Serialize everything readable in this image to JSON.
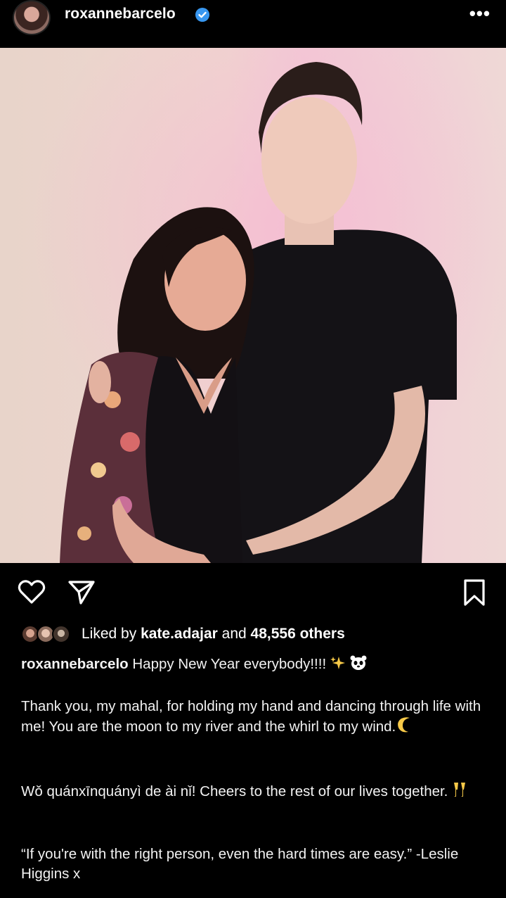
{
  "header": {
    "username": "roxannebarcelo",
    "verified_icon": "verified-badge-icon",
    "more_label": "•••",
    "accent": "#3897f0"
  },
  "post": {
    "photo_alt": "photo-of-couple"
  },
  "actions": {
    "like_icon": "heart-icon",
    "share_icon": "send-icon",
    "save_icon": "bookmark-icon"
  },
  "likes": {
    "prefix": "Liked by ",
    "user": "kate.adajar",
    "middle": " and ",
    "count": "48,556 others"
  },
  "caption": {
    "username": "roxannebarcelo",
    "line1": " Happy New Year everybody!!!! ",
    "para2": "Thank you, my mahal, for holding my hand and dancing through life with me! You are the moon to my river and the whirl to my wind.",
    "para3": "Wǒ quánxīnquányì de ài nǐ! Cheers to the rest of our lives together. ",
    "para4": "“If you're with the right person, even the hard times are easy.” -Leslie Higgins x"
  }
}
